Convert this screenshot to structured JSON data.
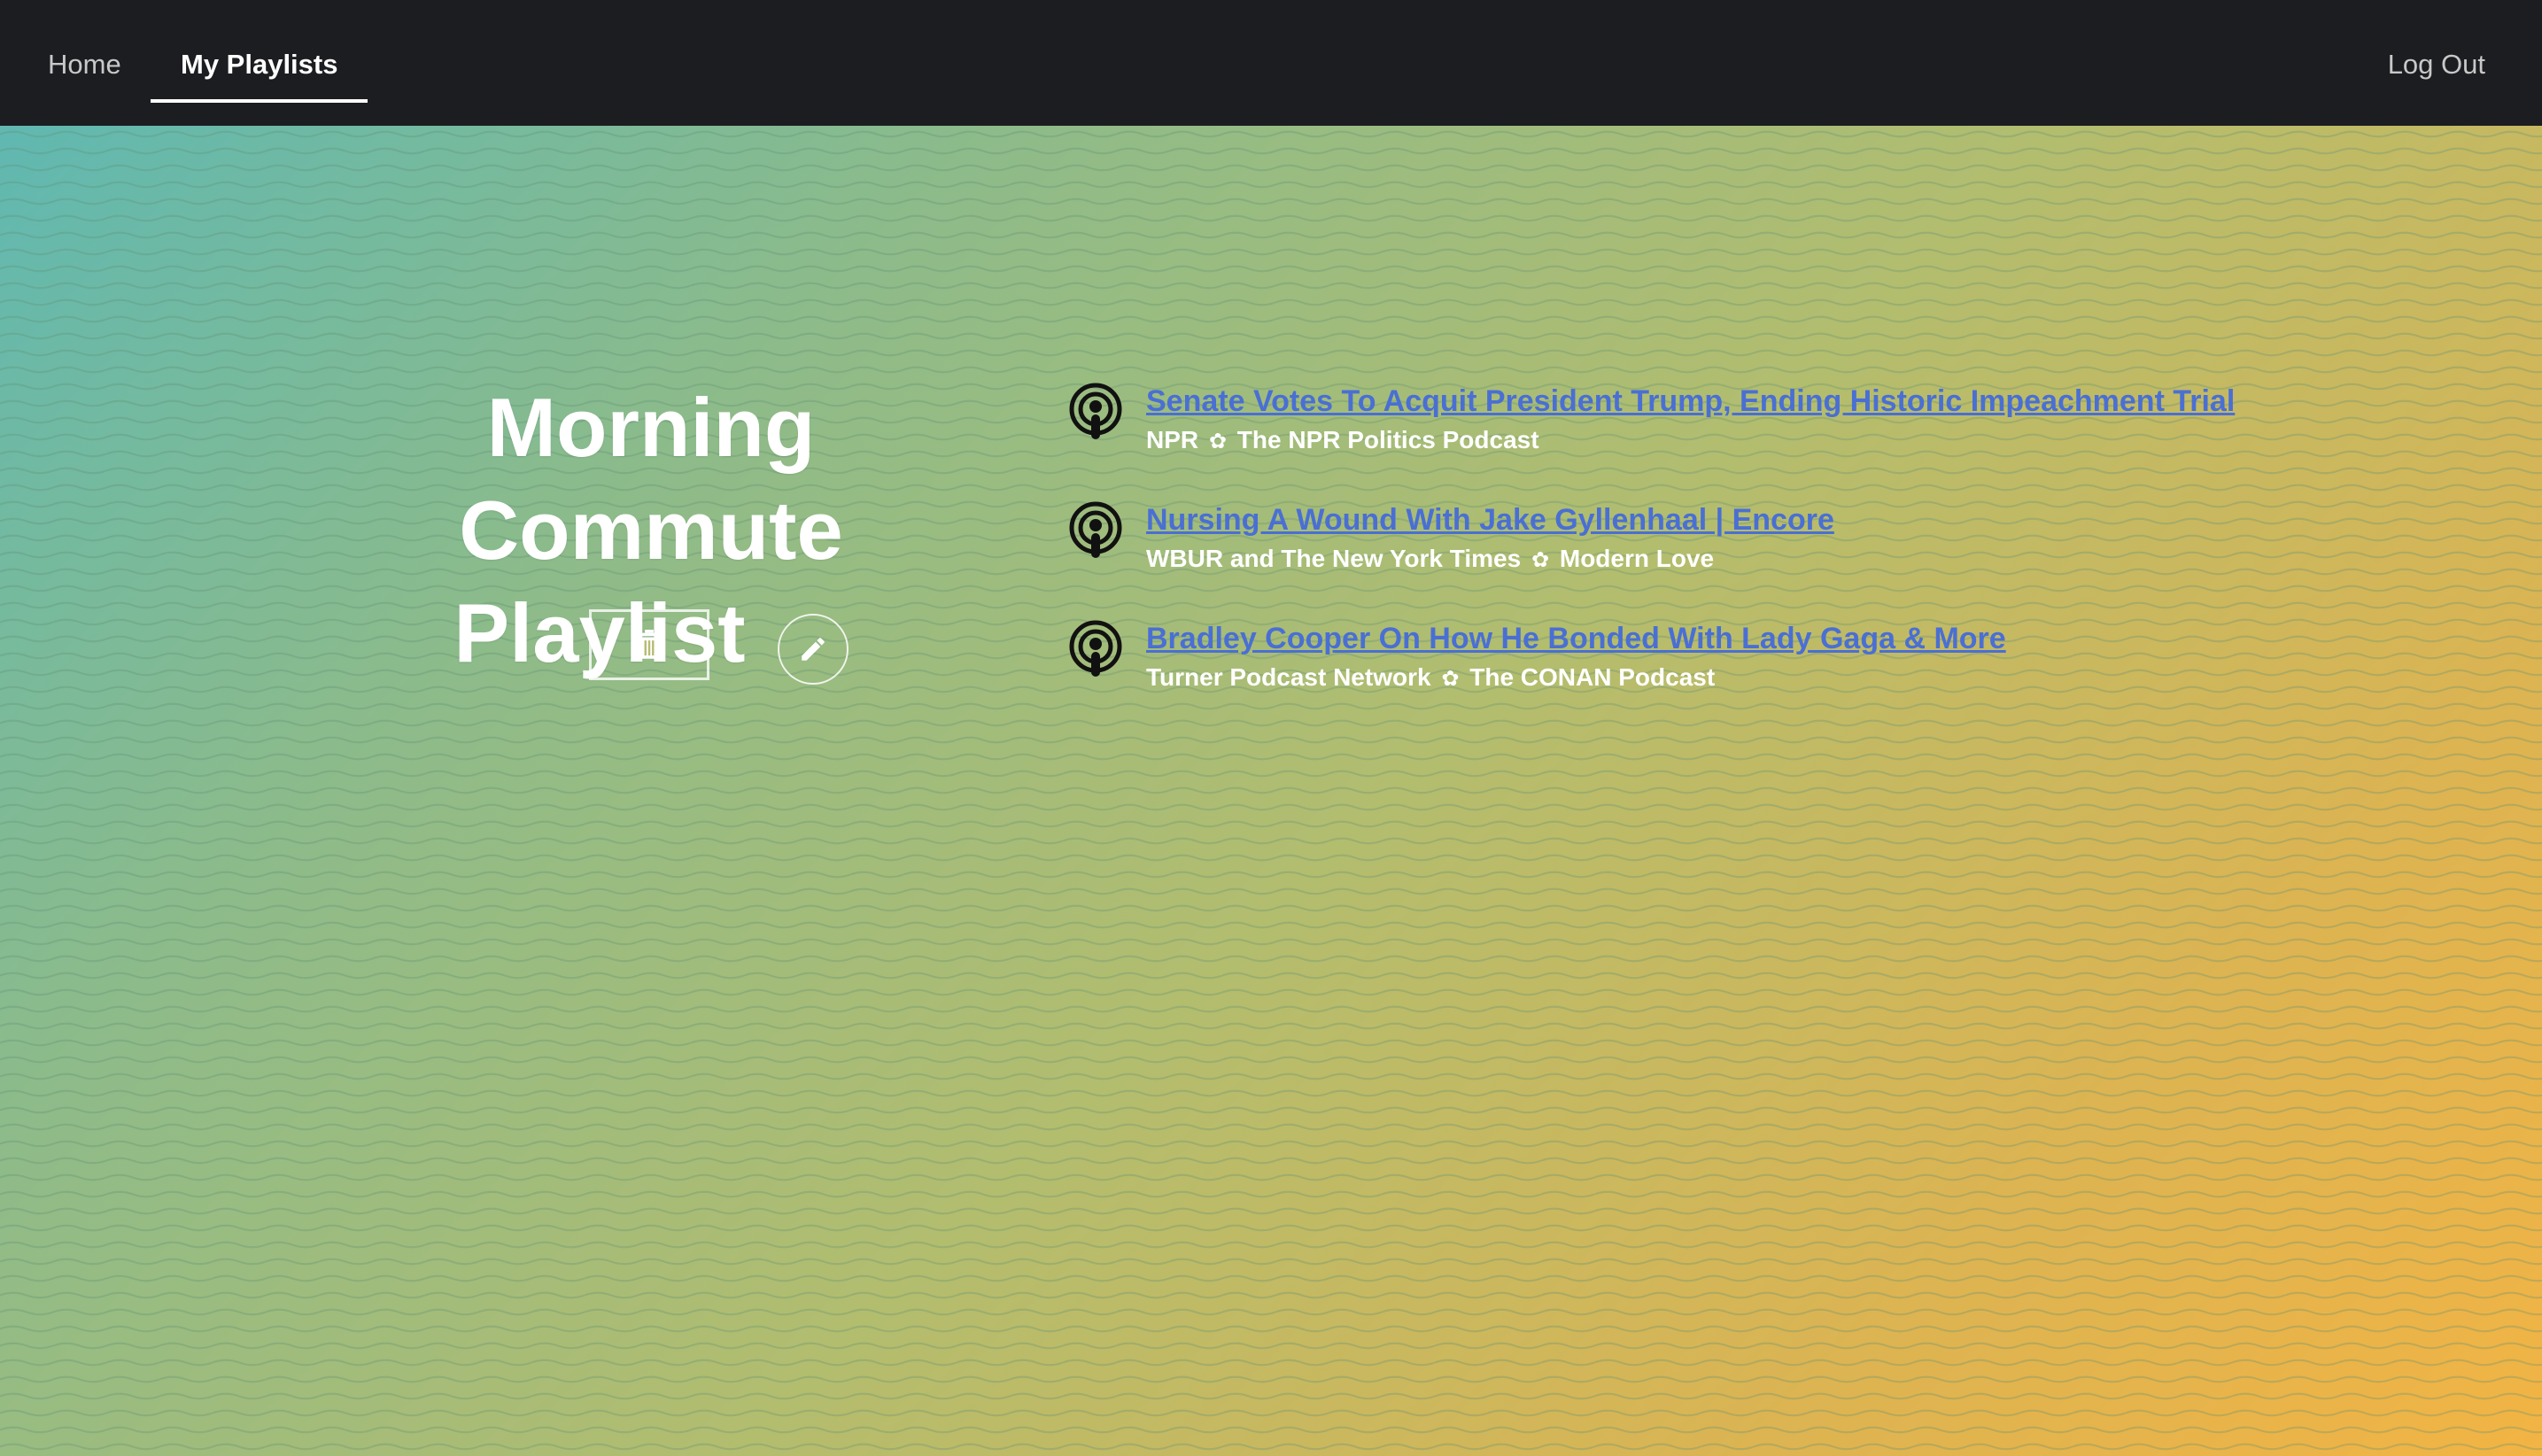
{
  "nav": {
    "home": "Home",
    "my_playlists": "My Playlists",
    "logout": "Log Out"
  },
  "playlist": {
    "title_line1": "Morning Commute",
    "title_line2": "Playlist",
    "edit_icon": "pencil-icon",
    "delete_icon": "trash-icon"
  },
  "separator": "✿",
  "episodes": [
    {
      "title": "Senate Votes To Acquit President Trump, Ending Historic Impeachment Trial",
      "publisher": "NPR",
      "podcast": "The NPR Politics Podcast",
      "icon": "podcast-icon"
    },
    {
      "title": "Nursing A Wound With Jake Gyllenhaal | Encore",
      "publisher": "WBUR and The New York Times",
      "podcast": "Modern Love",
      "icon": "podcast-icon"
    },
    {
      "title": "Bradley Cooper On How He Bonded With Lady Gaga & More",
      "publisher": "Turner Podcast Network",
      "podcast": "The CONAN Podcast",
      "icon": "podcast-icon"
    }
  ],
  "colors": {
    "topbar": "#1c1d21",
    "link": "#4a6fd4",
    "gradient_start": "#5ab8b6",
    "gradient_end": "#f2b444"
  }
}
